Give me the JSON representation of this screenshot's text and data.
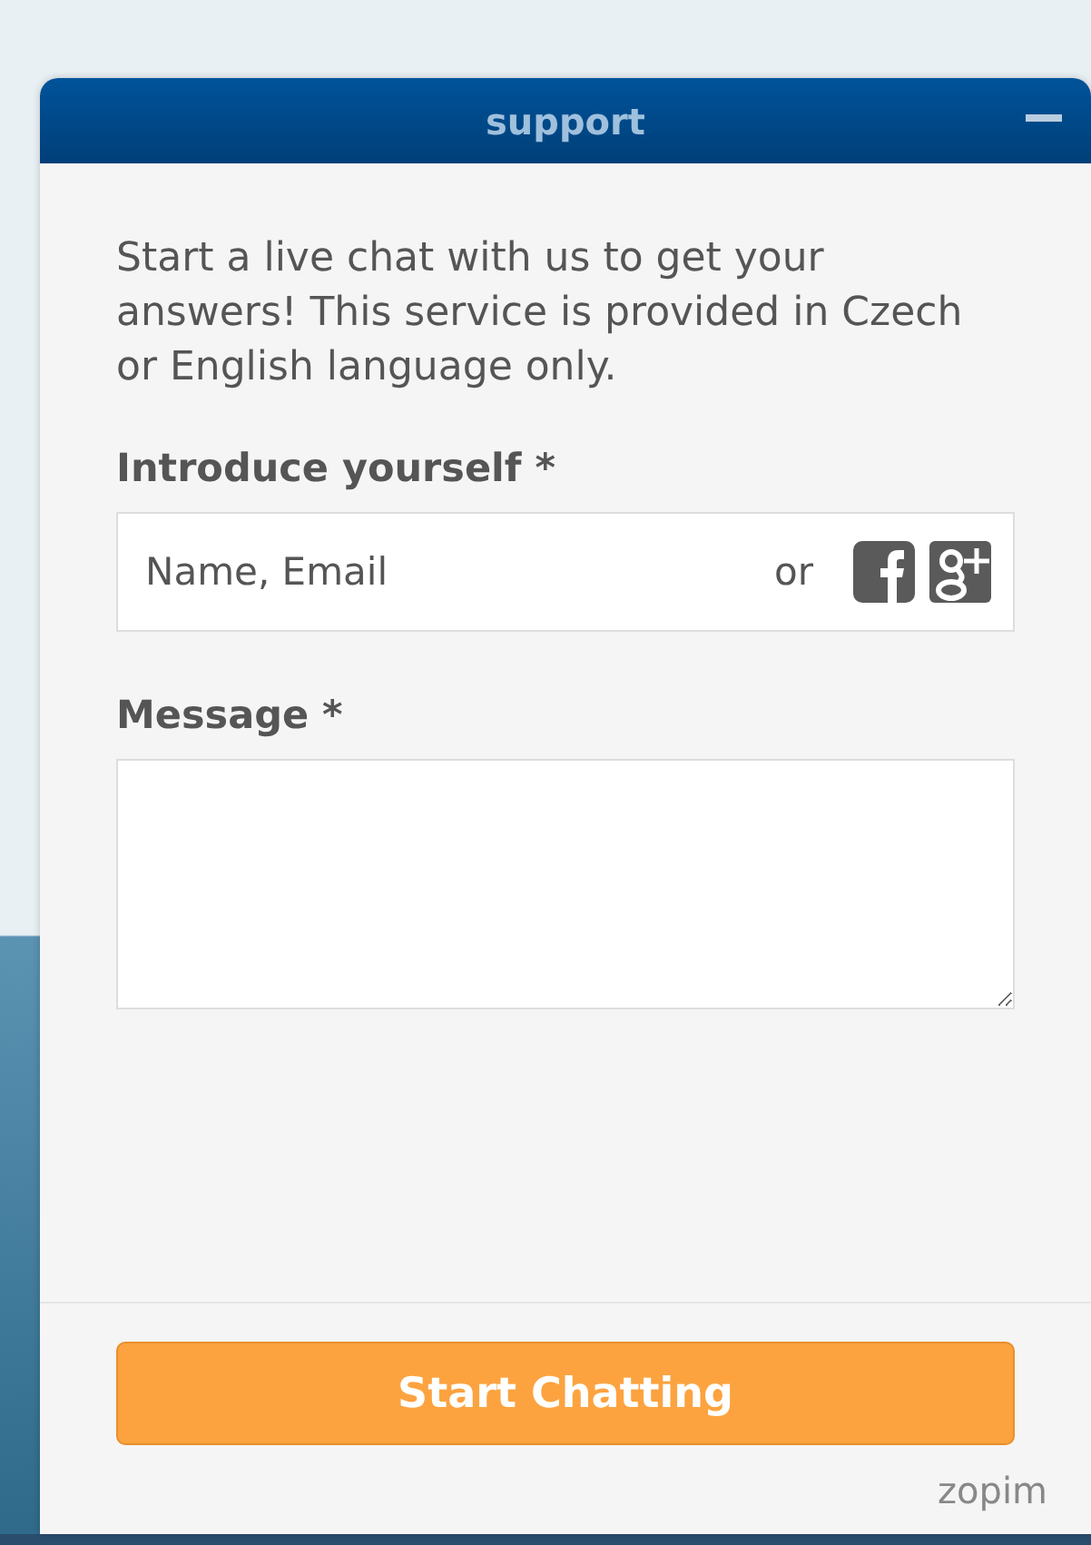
{
  "window": {
    "title": "support"
  },
  "intro": "Start a live chat with us to get your answers! This service is provided in Czech or English language only.",
  "name_field": {
    "label": "Introduce yourself *",
    "placeholder": "Name, Email",
    "or": "or"
  },
  "message_field": {
    "label": "Message *"
  },
  "button": "Start Chatting",
  "brand": "zopim"
}
